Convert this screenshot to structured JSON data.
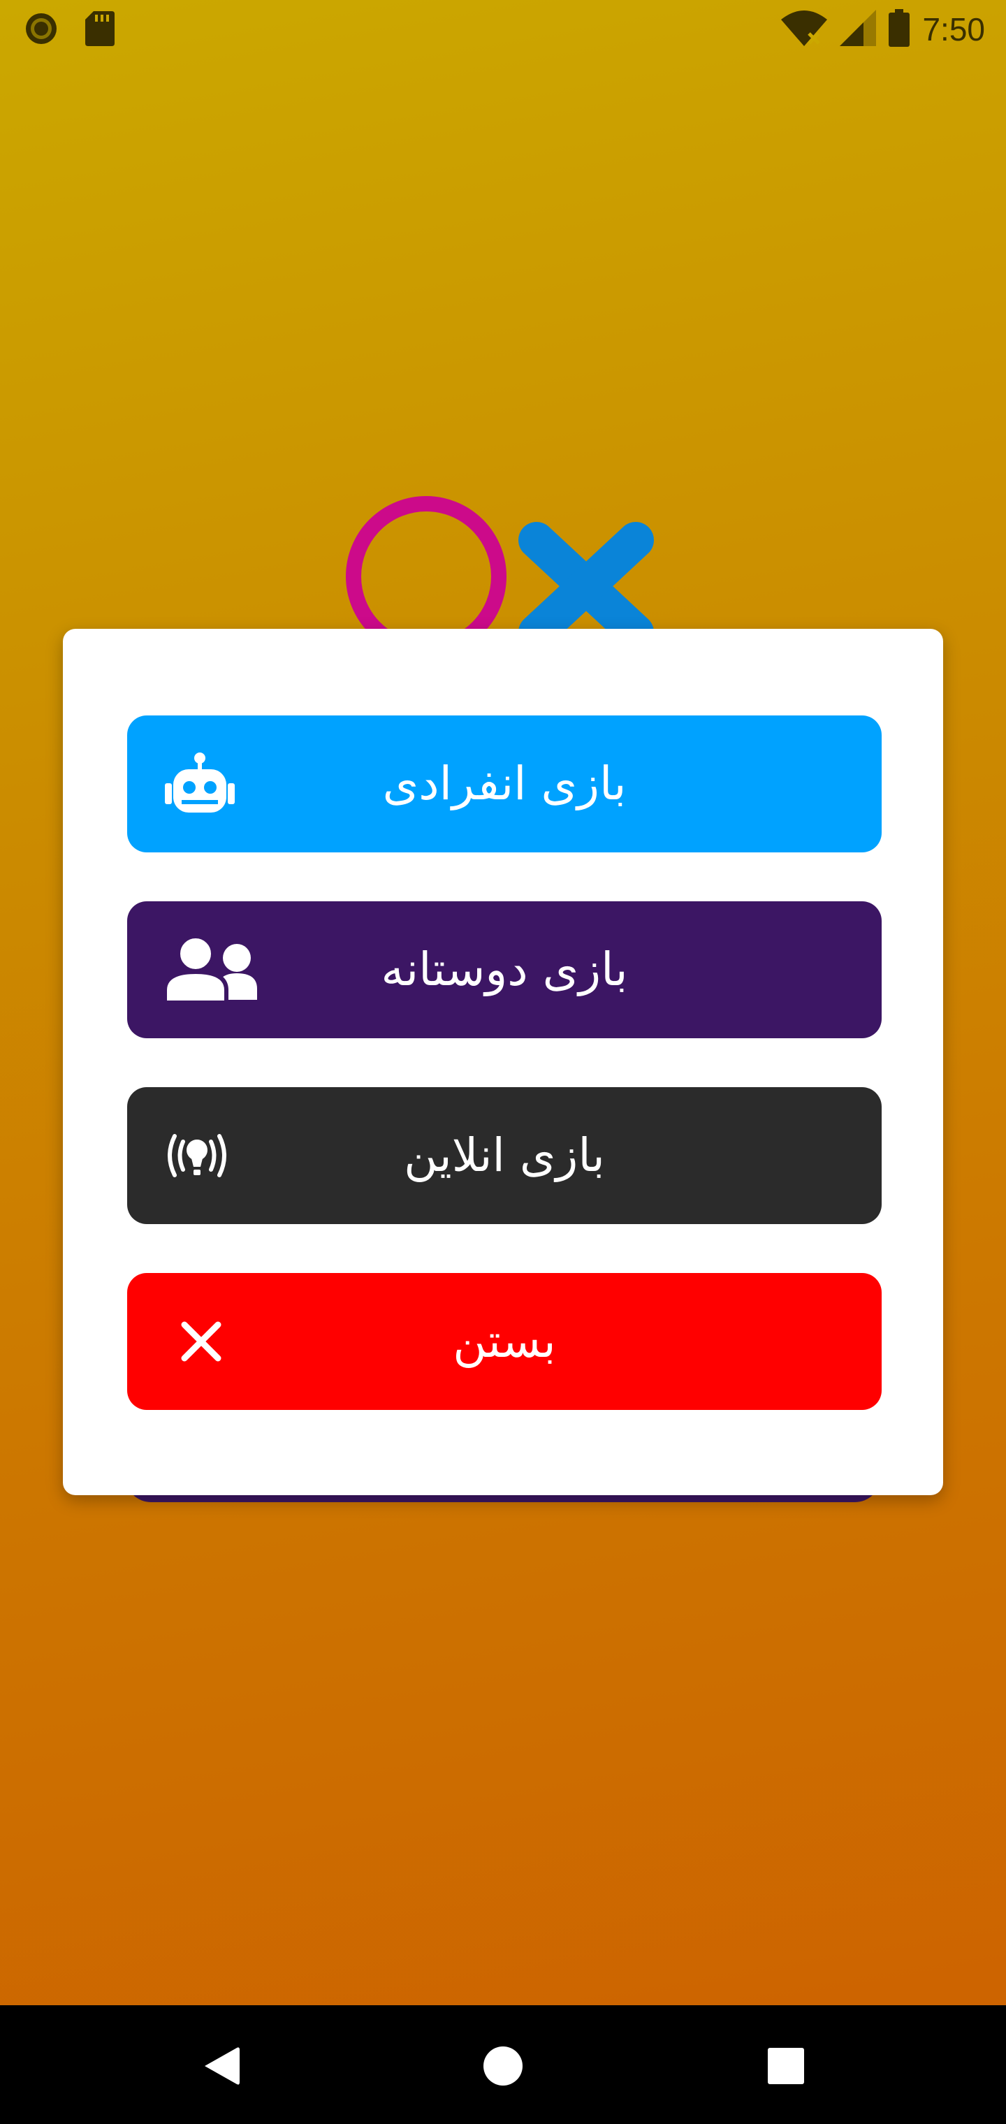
{
  "status_bar": {
    "time": "7:50",
    "icons": [
      "record-icon",
      "sd-card-icon",
      "wifi-off-icon",
      "signal-icon",
      "battery-icon"
    ]
  },
  "logo": {
    "symbols": [
      "O",
      "X"
    ],
    "colors": {
      "o": "#cc0a8a",
      "x": "#0a84d8"
    }
  },
  "dialog": {
    "buttons": [
      {
        "label": "بازی انفرادی",
        "icon": "robot-icon",
        "color": "#00a2ff"
      },
      {
        "label": "بازی دوستانه",
        "icon": "users-icon",
        "color": "#3c1664"
      },
      {
        "label": "بازی انلاین",
        "icon": "broadcast-icon",
        "color": "#2b2b2b"
      },
      {
        "label": "بستن",
        "icon": "close-icon",
        "color": "#ff0000"
      }
    ]
  },
  "nav_bar": {
    "buttons": [
      "back-icon",
      "home-icon",
      "recents-icon"
    ]
  },
  "colors": {
    "background_top": "#cba800",
    "background_bottom": "#cd6000",
    "dialog": "#ffffff"
  }
}
